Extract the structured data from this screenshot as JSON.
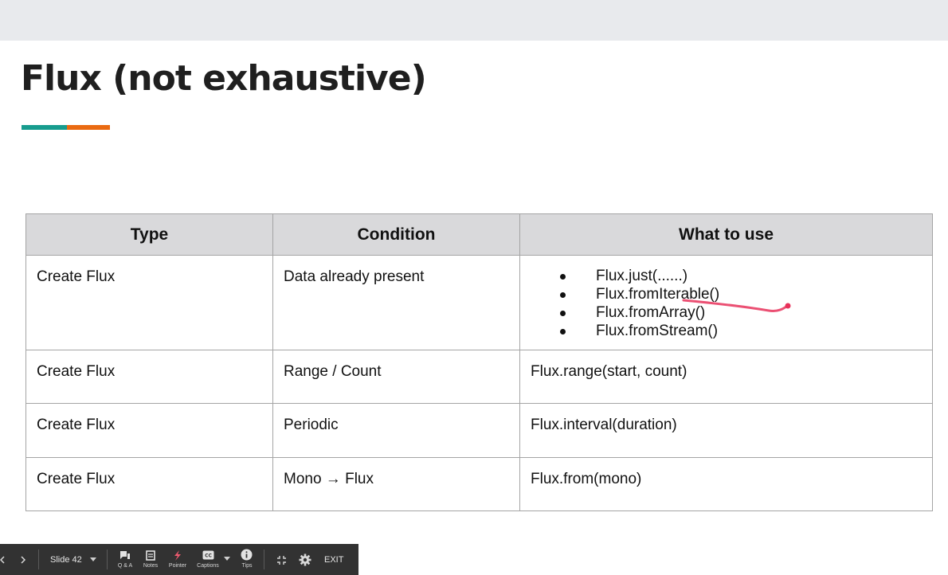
{
  "slide": {
    "title": "Flux (not exhaustive)",
    "accent_colors": [
      "#179c8e",
      "#ea6a11"
    ]
  },
  "table": {
    "headers": [
      "Type",
      "Condition",
      "What to use"
    ],
    "rows": [
      {
        "type": "Create Flux",
        "condition": "Data already present",
        "usage_items": [
          "Flux.just(......)",
          "Flux.fromIterable()",
          "Flux.fromArray()",
          "Flux.fromStream()"
        ]
      },
      {
        "type": "Create Flux",
        "condition": "Range / Count",
        "usage": "Flux.range(start, count)"
      },
      {
        "type": "Create Flux",
        "condition": "Periodic",
        "usage": "Flux.interval(duration)"
      },
      {
        "type": "Create Flux",
        "condition": "Mono → Flux",
        "usage": "Flux.from(mono)"
      }
    ]
  },
  "annotation": {
    "color": "#e8315a"
  },
  "toolbar": {
    "slide_select": "Slide 42",
    "qa_label": "Q & A",
    "notes_label": "Notes",
    "pointer_label": "Pointer",
    "captions_label": "Captions",
    "tips_label": "Tips",
    "exit_label": "EXIT",
    "icons": [
      "prev-icon",
      "next-icon",
      "chevron-down-icon",
      "qa-icon",
      "notes-icon",
      "pointer-icon",
      "captions-icon",
      "chevron-down-icon",
      "info-icon",
      "exit-fullscreen-icon",
      "gear-icon"
    ]
  }
}
